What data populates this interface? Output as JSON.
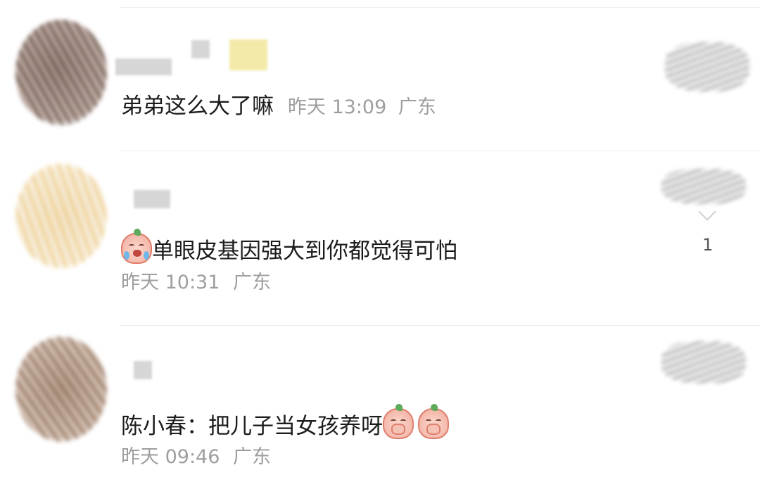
{
  "comments": [
    {
      "text": "弟弟这么大了嘛",
      "time": "昨天 13:09",
      "location": "广东",
      "emoji": [],
      "like_count": ""
    },
    {
      "text": "单眼皮基因强大到你都觉得可怕",
      "time": "昨天 10:31",
      "location": "广东",
      "emoji": [
        "crying-laughing-peach-icon"
      ],
      "like_count": "1"
    },
    {
      "text": "陈小春：把儿子当女孩养呀",
      "time": "昨天 09:46",
      "location": "广东",
      "emoji": [
        "shy-peach-icon",
        "shy-peach-icon"
      ],
      "like_count": ""
    }
  ],
  "colors": {
    "text": "#1c1c1c",
    "meta": "#9e9e9e",
    "divider": "#ececec"
  }
}
